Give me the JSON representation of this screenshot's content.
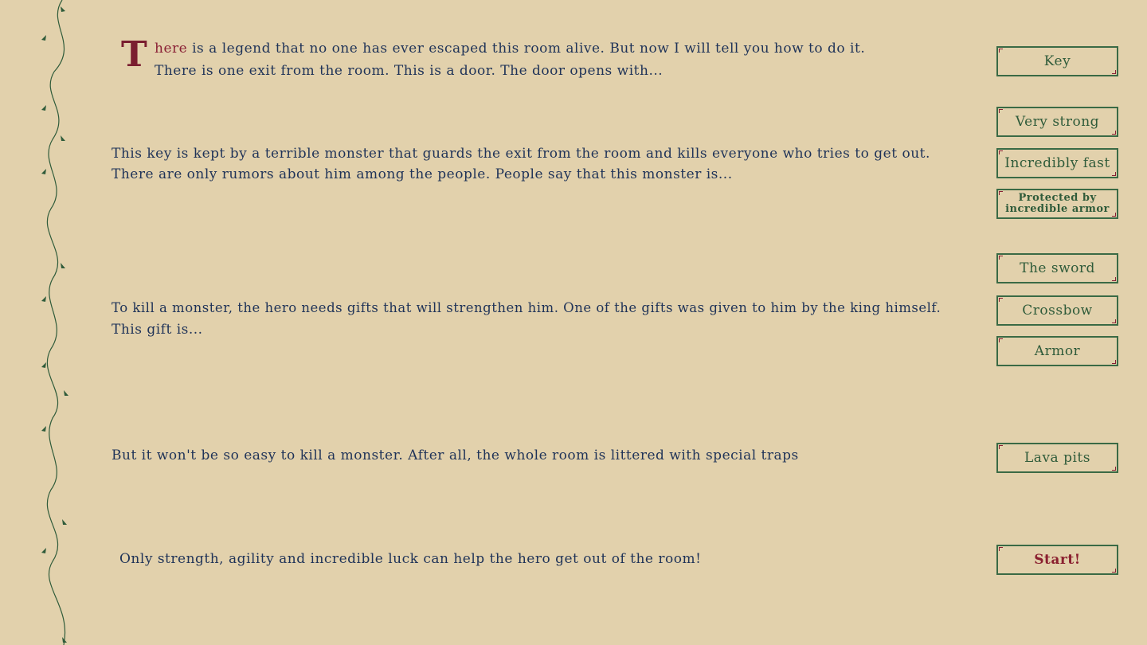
{
  "story": {
    "p1_dropcap": "T",
    "p1_accent": "here",
    "p1_line1_rest": " is a legend that no one has ever escaped this room alive. But now I will tell you how to do it.",
    "p1_line2": "There is one exit from the room. This is a door. The door opens with...",
    "p2_line1": "This key is kept by a terrible monster that guards the exit from the room and kills everyone who tries to get out.",
    "p2_line2": "There are only rumors about him among the people. People say that this monster is...",
    "p3_line1": "To kill a monster, the hero needs gifts that will strengthen him. One of the gifts was given to him by the king himself.",
    "p3_line2": "This gift is...",
    "p4_line1": "But it won't be so easy to kill a monster. After all, the whole room is littered with special traps",
    "p5_line1": "Only strength, agility and incredible luck can help the hero get out of the room!"
  },
  "choices": {
    "key": "Key",
    "very_strong": "Very strong",
    "incredibly_fast": "Incredibly fast",
    "protected_armor": "Protected by incredible armor",
    "the_sword": "The sword",
    "crossbow": "Crossbow",
    "armor": "Armor",
    "lava_pits": "Lava pits",
    "start": "Start!"
  },
  "colors": {
    "background": "#e2d1ac",
    "text": "#1f3358",
    "accent": "#8a2035",
    "button_border": "#3a6a45",
    "vine": "#2f5b3a"
  },
  "icons": [
    "vine-border-icon"
  ]
}
